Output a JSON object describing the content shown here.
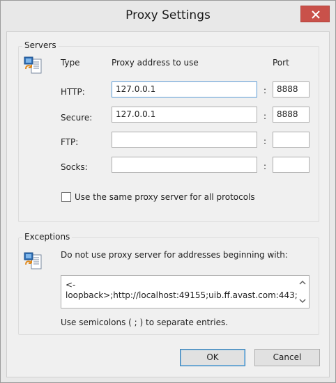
{
  "window": {
    "title": "Proxy Settings"
  },
  "servers": {
    "group_label": "Servers",
    "headers": {
      "type": "Type",
      "address": "Proxy address to use",
      "port": "Port"
    },
    "rows": [
      {
        "label": "HTTP:",
        "address": "127.0.0.1",
        "port": "8888"
      },
      {
        "label": "Secure:",
        "address": "127.0.0.1",
        "port": "8888"
      },
      {
        "label": "FTP:",
        "address": "",
        "port": ""
      },
      {
        "label": "Socks:",
        "address": "",
        "port": ""
      }
    ],
    "colon": ":",
    "same_proxy_label": "Use the same proxy server for all protocols",
    "same_proxy_checked": false
  },
  "exceptions": {
    "group_label": "Exceptions",
    "description": "Do not use proxy server for addresses beginning with:",
    "value_line1": "<-",
    "value_line2": "loopback>;http://localhost:49155;uib.ff.avast.com:443;",
    "hint": "Use semicolons ( ; ) to separate entries."
  },
  "buttons": {
    "ok": "OK",
    "cancel": "Cancel"
  },
  "icons": {
    "servers": "network-computer-icon",
    "exceptions": "network-computer-icon",
    "close": "close-icon"
  },
  "colors": {
    "close_button": "#c9514a",
    "focus_border": "#5b9bd5",
    "default_button_border": "#3c7fb1"
  }
}
